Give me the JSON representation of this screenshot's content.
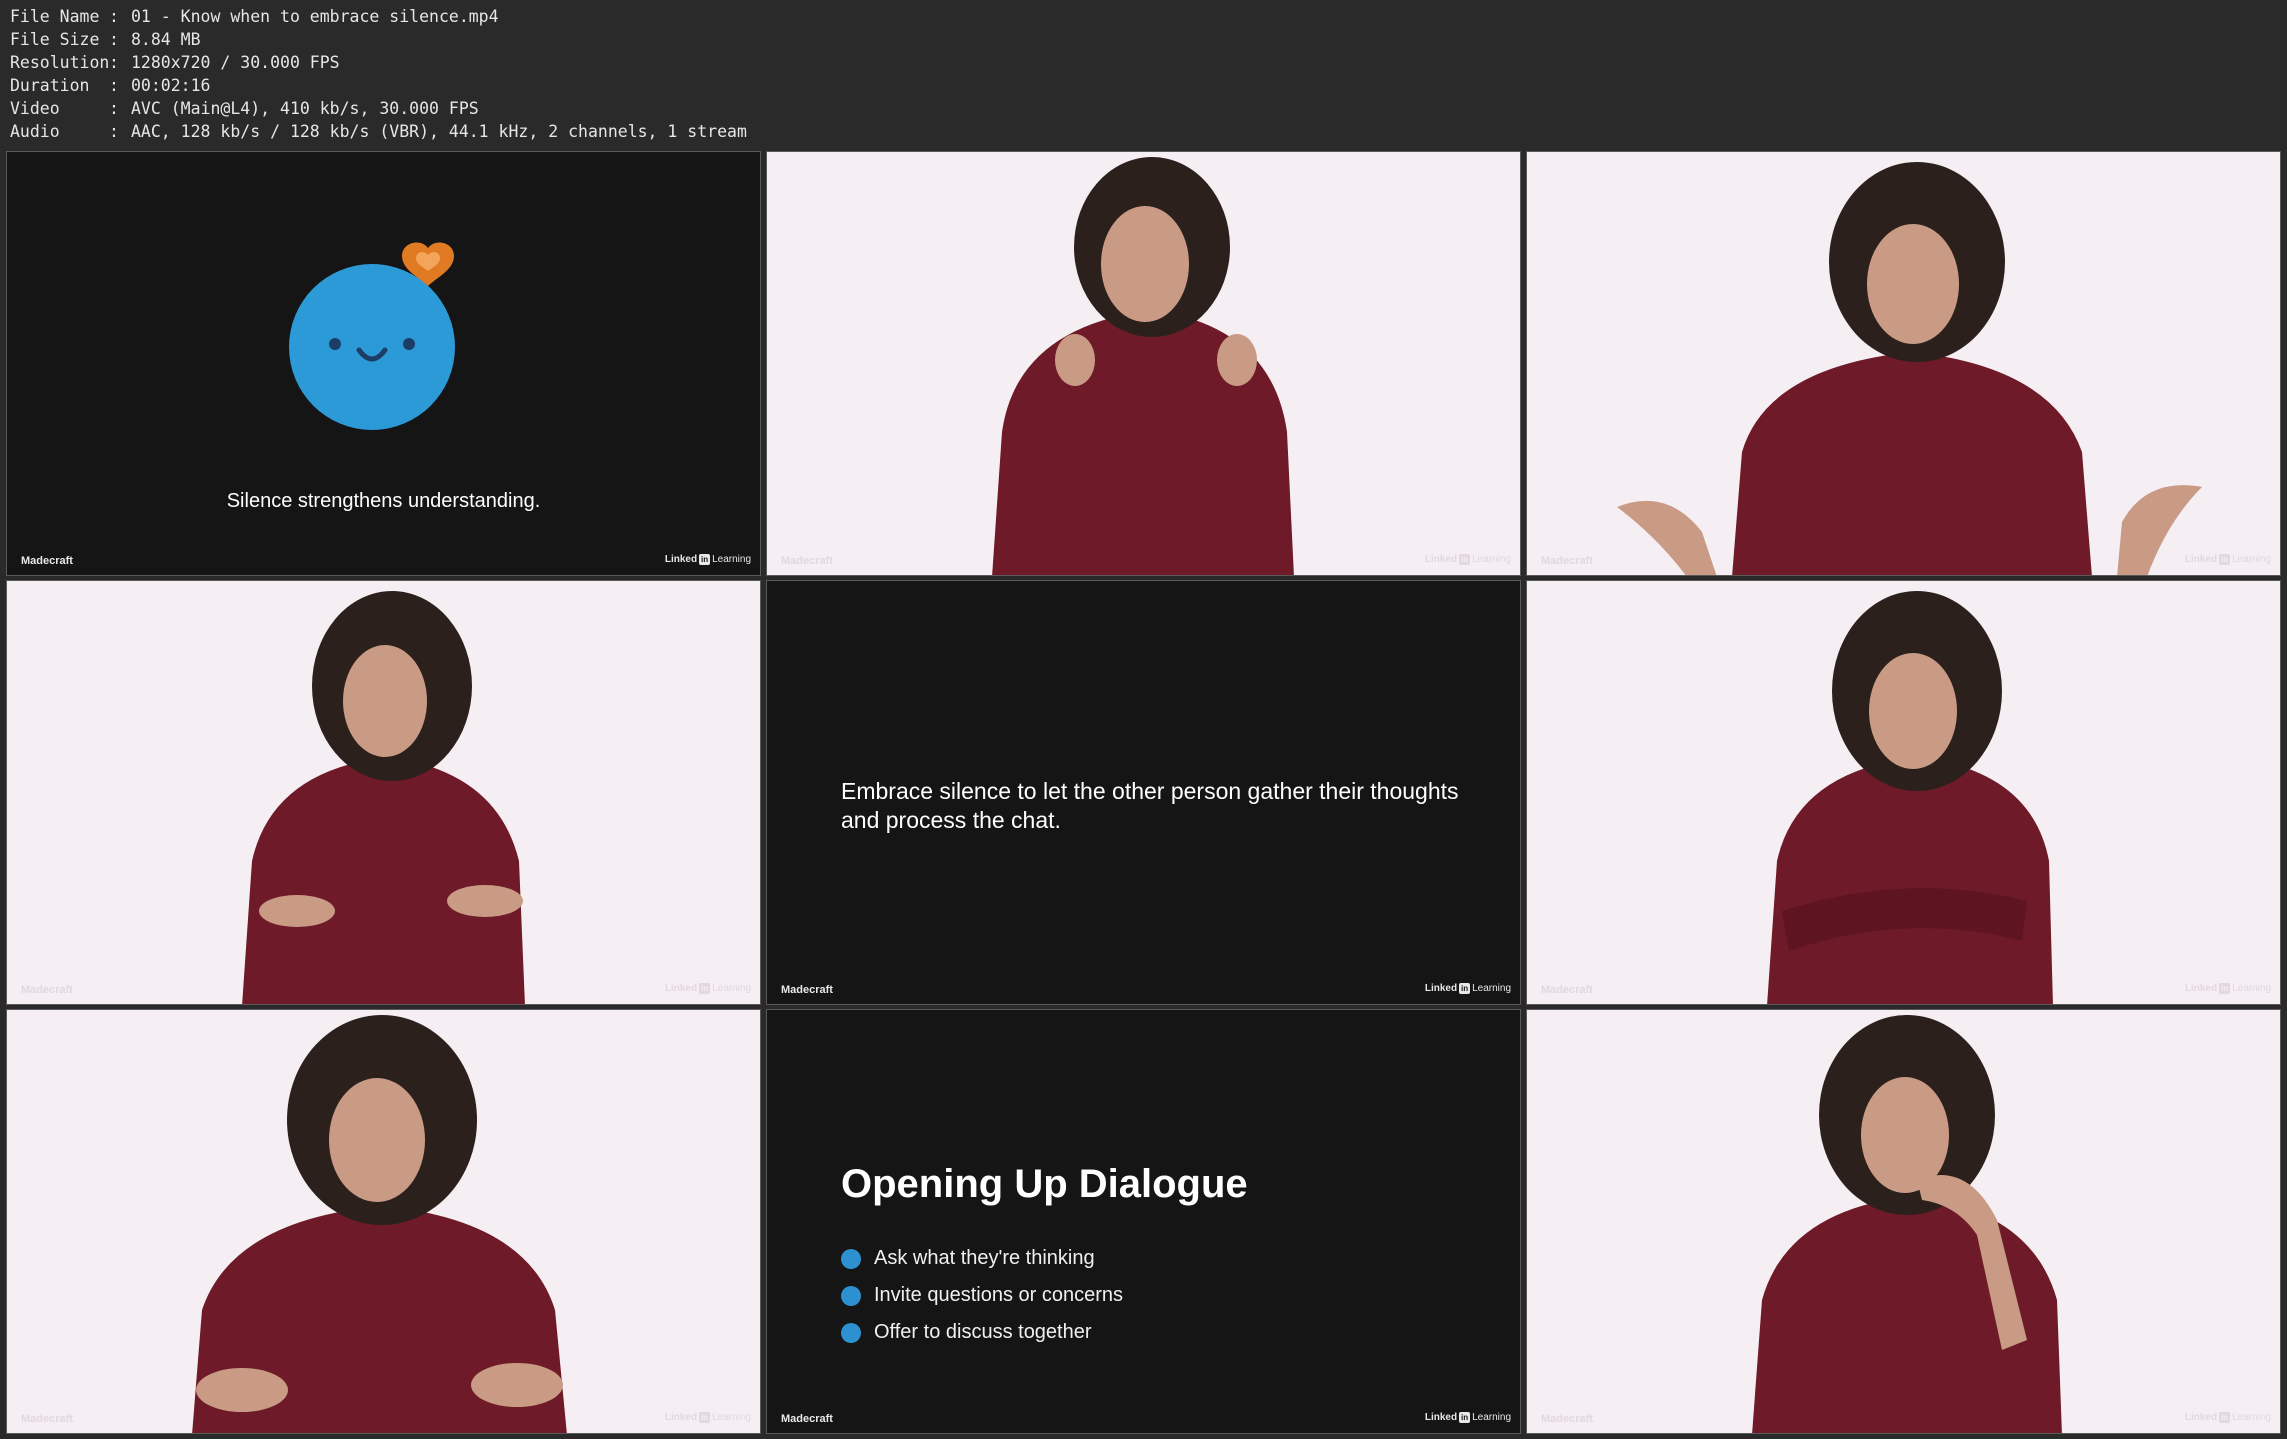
{
  "file_info": [
    {
      "key": "File Name",
      "value": "01 - Know when to embrace silence.mp4"
    },
    {
      "key": "File Size",
      "value": "8.84 MB"
    },
    {
      "key": "Resolution",
      "value": "1280x720 / 30.000 FPS"
    },
    {
      "key": "Duration",
      "value": "00:02:16"
    },
    {
      "key": "Video",
      "value": "AVC (Main@L4), 410 kb/s, 30.000 FPS"
    },
    {
      "key": "Audio",
      "value": "AAC, 128 kb/s / 128 kb/s (VBR), 44.1 kHz, 2 channels, 1 stream"
    }
  ],
  "separator": ":",
  "watermark": {
    "left": "Madecraft",
    "brand_a": "Linked",
    "brand_in": "in",
    "brand_b": "Learning"
  },
  "frames": {
    "f1": {
      "caption": "Silence strengthens understanding."
    },
    "f5": {
      "text": "Embrace silence to let the other person gather their thoughts and process the chat."
    },
    "f8": {
      "title": "Opening Up Dialogue",
      "bullets": [
        "Ask what they're thinking",
        "Invite questions or concerns",
        "Offer to discuss together"
      ]
    }
  },
  "colors": {
    "emoji_blue": "#2d9ad8",
    "heart_orange": "#e07b24",
    "bullet_blue": "#2d90d0",
    "shirt": "#6e1a28",
    "hair": "#2b201c",
    "skin": "#c99a84"
  }
}
